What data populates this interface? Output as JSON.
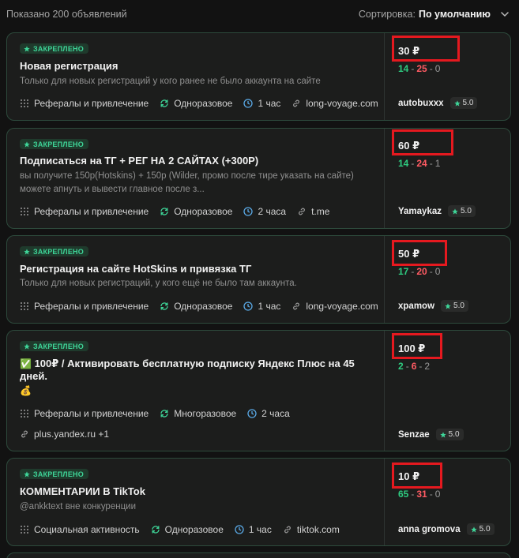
{
  "header": {
    "count_text": "Показано 200 объявлений",
    "sort_label": "Сортировка:",
    "sort_value": "По умолчанию"
  },
  "colors": {
    "accent": "#3ed598",
    "positive": "#2ecc80",
    "negative": "#ff5b63",
    "highlight_box": "#e5191f"
  },
  "cards": [
    {
      "badge": "ЗАКРЕПЛЕНО",
      "title": "Новая регистрация",
      "desc_lines": [
        "Только для новых регистраций у кого ранее не было аккаунта на сайте"
      ],
      "category": "Рефералы и привлечение",
      "frequency": "Одноразовое",
      "time": "1 час",
      "link": "long-voyage.com",
      "price": "30 ₽",
      "stats": {
        "good": "14",
        "bad": "25",
        "neutral": "0"
      },
      "author": "autobuxxx",
      "rating": "5.0"
    },
    {
      "badge": "ЗАКРЕПЛЕНО",
      "title": "Подписаться на ТГ + РЕГ НА 2 САЙТАХ (+300Р)",
      "desc_lines": [
        "вы получите 150р(Hotskins) + 150р (Wilder, промо после тире указать на сайте)",
        "можете апнуть и вывести главное после з..."
      ],
      "category": "Рефералы и привлечение",
      "frequency": "Одноразовое",
      "time": "2 часа",
      "link": "t.me",
      "price": "60 ₽",
      "stats": {
        "good": "14",
        "bad": "24",
        "neutral": "1"
      },
      "author": "Yamaykaz",
      "rating": "5.0"
    },
    {
      "badge": "ЗАКРЕПЛЕНО",
      "title": "Регистрация на сайте HotSkins и привязка ТГ",
      "desc_lines": [
        "Только для новых регистраций, у кого ещё не было там аккаунта."
      ],
      "category": "Рефералы и привлечение",
      "frequency": "Одноразовое",
      "time": "1 час",
      "link": "long-voyage.com",
      "price": "50 ₽",
      "stats": {
        "good": "17",
        "bad": "20",
        "neutral": "0"
      },
      "author": "xpamow",
      "rating": "5.0"
    },
    {
      "badge": "ЗАКРЕПЛЕНО",
      "title_emoji": "✅",
      "title_line1": "100₽ / Активировать бесплатную подписку Яндекс Плюс на 45",
      "title_line2": "дней.",
      "desc_emoji": "💰",
      "category": "Рефералы и привлечение",
      "frequency": "Многоразовое",
      "time": "2 часа",
      "link": "plus.yandex.ru +1",
      "price": "100 ₽",
      "stats": {
        "good": "2",
        "bad": "6",
        "neutral": "2"
      },
      "author": "Senzae",
      "rating": "5.0"
    },
    {
      "badge": "ЗАКРЕПЛЕНО",
      "title": "КОММЕНТАРИИ В TikTok",
      "desc_lines": [
        "@ankktext вне конкуренции"
      ],
      "category": "Социальная активность",
      "frequency": "Одноразовое",
      "time": "1 час",
      "link": "tiktok.com",
      "price": "10 ₽",
      "stats": {
        "good": "65",
        "bad": "31",
        "neutral": "0"
      },
      "author": "anna gromova",
      "rating": "5.0"
    }
  ]
}
